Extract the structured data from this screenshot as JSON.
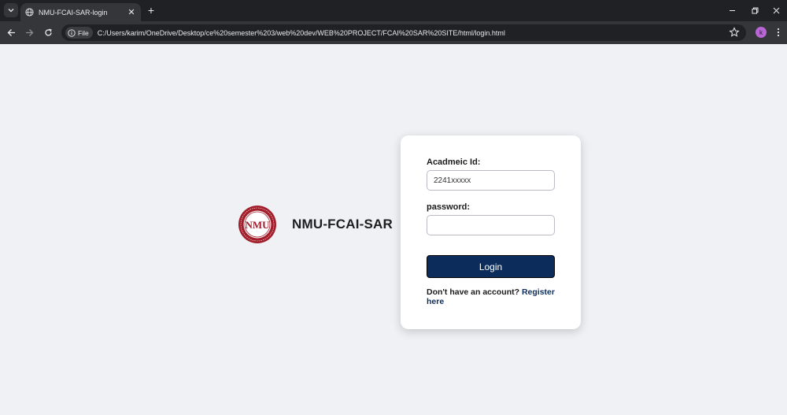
{
  "browser": {
    "tab_title": "NMU-FCAI-SAR-login",
    "tab_close": "✕",
    "new_tab": "+",
    "chip_label": "File",
    "url": "C:/Users/karim/OneDrive/Desktop/ce%20semester%203/web%20dev/WEB%20PROJECT/FCAI%20SAR%20SITE/html/login.html",
    "profile_initial": "k"
  },
  "page": {
    "brand_name": "NMU-FCAI-SAR",
    "logo_letters": "NMU"
  },
  "form": {
    "id_label": "Acadmeic Id:",
    "id_value": "2241xxxxx",
    "password_label": "password:",
    "password_value": "",
    "login_label": "Login",
    "footer_text": "Don't have an account?",
    "register_link": "Register here"
  },
  "colors": {
    "primary": "#0c2d5b",
    "logo": "#a31e2b",
    "background": "#f0f1f5"
  }
}
